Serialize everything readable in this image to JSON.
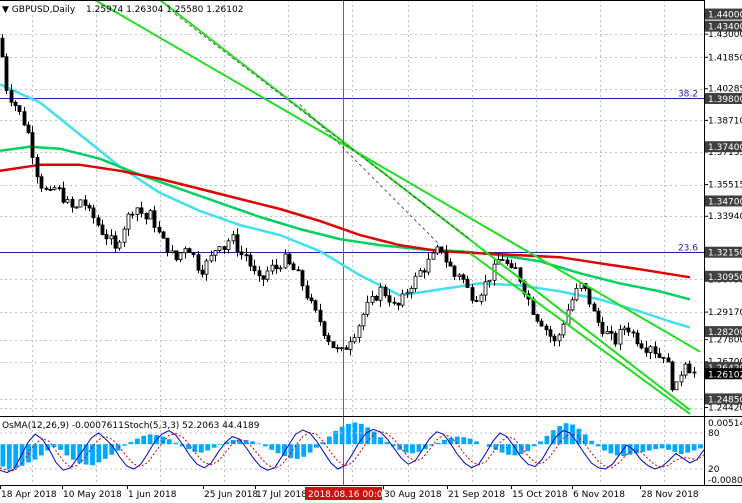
{
  "header": {
    "symbol_label": "GBPUSD,Daily",
    "ohlc_text": "1.25974 1.26304 1.25580 1.26102"
  },
  "indicator_header": {
    "osma_text": "OsMA(12,26,9) -0.0007611",
    "stoch_text": "Stoch(5,3,3) 52.2063 44.4189"
  },
  "colors": {
    "background": "#ffffff",
    "grid": "#c0c0c0",
    "axis_label": "#000000",
    "candle": "#000000",
    "ema_red": "#e00000",
    "ma_green": "#00d060",
    "ma_cyan": "#40e0f0",
    "channel": "#22dd22",
    "fib_line": "#2020a0",
    "fib_text": "#2020c0",
    "vline": "#c04040",
    "osma_bar": "#00a8ff",
    "stoch_main": "#0000d0",
    "stoch_signal": "#d00000",
    "price_tag_bg": "#000000",
    "price_tag_fg": "#ffffff",
    "time_tag_bg": "#d01010"
  },
  "chart_data": {
    "type": "candlestick",
    "price_axis": {
      "ylim": [
        1.24,
        1.447
      ],
      "ticks": [
        "1.43000",
        "1.41850",
        "1.40285",
        "1.38710",
        "1.37135",
        "1.35515",
        "1.33940",
        "1.32150",
        "1.30795",
        "1.29170",
        "1.27800",
        "1.26700",
        "1.24850",
        "1.24420"
      ],
      "highlighted_levels": [
        "1.44000",
        "1.43400",
        "1.39800",
        "1.37400",
        "1.34700",
        "1.32150",
        "1.30950",
        "1.28200",
        "1.26420",
        "1.26102",
        "1.24850"
      ],
      "current_price": "1.26102"
    },
    "fib_levels": [
      {
        "label": "38.2",
        "price": 1.398
      },
      {
        "label": "23.6",
        "price": 1.3215
      }
    ],
    "x_axis": {
      "labels": [
        "18 Apr 2018",
        "10 May 2018",
        "1 Jun 2018",
        "25 Jun 2018",
        "17 Jul 2018",
        "2018.08.16 00:00",
        "30 Aug 2018",
        "21 Sep 2018",
        "15 Oct 2018",
        "6 Nov 2018",
        "28 Nov 2018"
      ],
      "highlighted_label_index": 5
    },
    "indicator_axis": {
      "top_label": "0.005141",
      "stoch_80": "80",
      "stoch_20": "20",
      "bottom_label": "-0.00803"
    },
    "close_path": [
      [
        0,
        1.428
      ],
      [
        5,
        1.405
      ],
      [
        10,
        1.399
      ],
      [
        15,
        1.395
      ],
      [
        20,
        1.39
      ],
      [
        25,
        1.385
      ],
      [
        30,
        1.378
      ],
      [
        35,
        1.364
      ],
      [
        40,
        1.356
      ],
      [
        45,
        1.352
      ],
      [
        50,
        1.35
      ],
      [
        55,
        1.354
      ],
      [
        60,
        1.351
      ],
      [
        65,
        1.347
      ],
      [
        70,
        1.344
      ],
      [
        75,
        1.342
      ],
      [
        80,
        1.348
      ],
      [
        85,
        1.345
      ],
      [
        90,
        1.34
      ],
      [
        95,
        1.338
      ],
      [
        100,
        1.333
      ],
      [
        105,
        1.33
      ],
      [
        110,
        1.328
      ],
      [
        115,
        1.322
      ],
      [
        120,
        1.33
      ],
      [
        125,
        1.336
      ],
      [
        130,
        1.341
      ],
      [
        135,
        1.345
      ],
      [
        140,
        1.342
      ],
      [
        145,
        1.338
      ],
      [
        150,
        1.34
      ],
      [
        155,
        1.335
      ],
      [
        160,
        1.329
      ],
      [
        165,
        1.325
      ],
      [
        170,
        1.322
      ],
      [
        175,
        1.317
      ],
      [
        180,
        1.321
      ],
      [
        185,
        1.325
      ],
      [
        190,
        1.323
      ],
      [
        195,
        1.318
      ],
      [
        200,
        1.312
      ],
      [
        205,
        1.315
      ],
      [
        210,
        1.318
      ],
      [
        215,
        1.323
      ],
      [
        220,
        1.327
      ],
      [
        225,
        1.323
      ],
      [
        230,
        1.33
      ],
      [
        235,
        1.326
      ],
      [
        240,
        1.32
      ],
      [
        245,
        1.321
      ],
      [
        250,
        1.315
      ],
      [
        255,
        1.31
      ],
      [
        260,
        1.306
      ],
      [
        265,
        1.31
      ],
      [
        270,
        1.314
      ],
      [
        275,
        1.313
      ],
      [
        280,
        1.316
      ],
      [
        285,
        1.318
      ],
      [
        290,
        1.314
      ],
      [
        295,
        1.312
      ],
      [
        300,
        1.308
      ],
      [
        305,
        1.302
      ],
      [
        310,
        1.296
      ],
      [
        315,
        1.291
      ],
      [
        320,
        1.287
      ],
      [
        325,
        1.281
      ],
      [
        330,
        1.277
      ],
      [
        335,
        1.273
      ],
      [
        340,
        1.271
      ],
      [
        345,
        1.274
      ],
      [
        350,
        1.279
      ],
      [
        355,
        1.282
      ],
      [
        360,
        1.287
      ],
      [
        365,
        1.293
      ],
      [
        370,
        1.296
      ],
      [
        375,
        1.299
      ],
      [
        380,
        1.303
      ],
      [
        385,
        1.301
      ],
      [
        390,
        1.298
      ],
      [
        395,
        1.293
      ],
      [
        400,
        1.296
      ],
      [
        405,
        1.301
      ],
      [
        410,
        1.305
      ],
      [
        415,
        1.308
      ],
      [
        420,
        1.312
      ],
      [
        425,
        1.314
      ],
      [
        430,
        1.318
      ],
      [
        435,
        1.32
      ],
      [
        440,
        1.325
      ],
      [
        445,
        1.318
      ],
      [
        450,
        1.314
      ],
      [
        455,
        1.309
      ],
      [
        460,
        1.312
      ],
      [
        465,
        1.305
      ],
      [
        470,
        1.301
      ],
      [
        475,
        1.299
      ],
      [
        480,
        1.302
      ],
      [
        485,
        1.306
      ],
      [
        490,
        1.31
      ],
      [
        495,
        1.314
      ],
      [
        500,
        1.32
      ],
      [
        505,
        1.317
      ],
      [
        510,
        1.311
      ],
      [
        515,
        1.313
      ],
      [
        520,
        1.308
      ],
      [
        525,
        1.302
      ],
      [
        530,
        1.296
      ],
      [
        535,
        1.29
      ],
      [
        540,
        1.288
      ],
      [
        545,
        1.284
      ],
      [
        550,
        1.28
      ],
      [
        555,
        1.276
      ],
      [
        560,
        1.282
      ],
      [
        565,
        1.29
      ],
      [
        570,
        1.296
      ],
      [
        575,
        1.301
      ],
      [
        580,
        1.305
      ],
      [
        585,
        1.302
      ],
      [
        590,
        1.296
      ],
      [
        595,
        1.289
      ],
      [
        600,
        1.285
      ],
      [
        605,
        1.282
      ],
      [
        610,
        1.279
      ],
      [
        615,
        1.277
      ],
      [
        620,
        1.281
      ],
      [
        625,
        1.285
      ],
      [
        630,
        1.283
      ],
      [
        635,
        1.279
      ],
      [
        640,
        1.277
      ],
      [
        645,
        1.274
      ],
      [
        650,
        1.276
      ],
      [
        655,
        1.272
      ],
      [
        660,
        1.269
      ],
      [
        665,
        1.272
      ],
      [
        670,
        1.258
      ],
      [
        675,
        1.252
      ],
      [
        680,
        1.261
      ],
      [
        685,
        1.268
      ],
      [
        690,
        1.263
      ],
      [
        695,
        1.261
      ]
    ],
    "ema_red": [
      [
        0,
        1.362
      ],
      [
        40,
        1.365
      ],
      [
        80,
        1.365
      ],
      [
        120,
        1.362
      ],
      [
        160,
        1.358
      ],
      [
        200,
        1.353
      ],
      [
        240,
        1.348
      ],
      [
        280,
        1.343
      ],
      [
        320,
        1.337
      ],
      [
        360,
        1.33
      ],
      [
        400,
        1.325
      ],
      [
        440,
        1.322
      ],
      [
        480,
        1.321
      ],
      [
        520,
        1.32
      ],
      [
        560,
        1.319
      ],
      [
        600,
        1.316
      ],
      [
        640,
        1.313
      ],
      [
        690,
        1.309
      ]
    ],
    "ma_green": [
      [
        0,
        1.372
      ],
      [
        30,
        1.374
      ],
      [
        60,
        1.373
      ],
      [
        100,
        1.368
      ],
      [
        140,
        1.36
      ],
      [
        180,
        1.353
      ],
      [
        220,
        1.346
      ],
      [
        260,
        1.339
      ],
      [
        300,
        1.333
      ],
      [
        340,
        1.328
      ],
      [
        380,
        1.325
      ],
      [
        420,
        1.323
      ],
      [
        460,
        1.322
      ],
      [
        500,
        1.32
      ],
      [
        540,
        1.317
      ],
      [
        580,
        1.311
      ],
      [
        620,
        1.306
      ],
      [
        660,
        1.302
      ],
      [
        690,
        1.298
      ]
    ],
    "ma_cyan": [
      [
        0,
        1.405
      ],
      [
        40,
        1.396
      ],
      [
        80,
        1.38
      ],
      [
        120,
        1.364
      ],
      [
        160,
        1.351
      ],
      [
        200,
        1.342
      ],
      [
        240,
        1.335
      ],
      [
        280,
        1.33
      ],
      [
        320,
        1.322
      ],
      [
        360,
        1.31
      ],
      [
        400,
        1.3
      ],
      [
        440,
        1.303
      ],
      [
        480,
        1.306
      ],
      [
        520,
        1.305
      ],
      [
        560,
        1.302
      ],
      [
        600,
        1.298
      ],
      [
        640,
        1.292
      ],
      [
        670,
        1.287
      ],
      [
        690,
        1.284
      ]
    ],
    "channel_lines": [
      {
        "x0": 95,
        "y0": 1.447,
        "x1": 700,
        "y1": 1.272
      },
      {
        "x0": 160,
        "y0": 1.447,
        "x1": 690,
        "y1": 1.243
      },
      {
        "x0": 300,
        "y0": 1.395,
        "x1": 440,
        "y1": 1.325
      },
      {
        "x0": 470,
        "y0": 1.321,
        "x1": 690,
        "y1": 1.241
      }
    ],
    "osma": [
      -3.2,
      -3.6,
      -3.4,
      -3.1,
      -2.6,
      -2.2,
      -1.6,
      -0.9,
      -0.4,
      -0.8,
      -1.6,
      -2.2,
      -2.7,
      -2.9,
      -3.0,
      -2.6,
      -2.1,
      -1.5,
      -0.9,
      -0.2,
      0.3,
      0.8,
      1.2,
      1.4,
      1.3,
      1.1,
      0.7,
      0.2,
      -0.3,
      -0.7,
      -1.1,
      -1.2,
      -0.9,
      -0.5,
      -0.1,
      0.3,
      0.6,
      0.7,
      0.6,
      0.4,
      0.1,
      -0.3,
      -0.8,
      -1.3,
      -1.7,
      -2.0,
      -2.1,
      -1.8,
      -1.2,
      -0.5,
      0.3,
      1.1,
      1.9,
      2.5,
      2.9,
      3.1,
      2.9,
      2.4,
      1.8,
      1.0,
      0.3,
      -0.3,
      -0.8,
      -1.2,
      -1.3,
      -1.1,
      -0.7,
      -0.2,
      0.2,
      0.6,
      0.9,
      1.1,
      1.0,
      0.8,
      0.4,
      0.0,
      -0.4,
      -0.8,
      -1.2,
      -1.5,
      -1.6,
      -1.4,
      -1.0,
      -0.3,
      0.4,
      1.2,
      2.0,
      2.6,
      3.0,
      2.8,
      2.2,
      1.4,
      0.5,
      -0.3,
      -0.9,
      -1.3,
      -1.6,
      -1.7,
      -1.5,
      -1.3,
      -1.1,
      -0.9,
      -0.7,
      -0.6,
      -0.8,
      -1.1,
      -1.4,
      -1.2,
      -0.9,
      -0.6
    ],
    "stoch_main": [
      18,
      14,
      20,
      42,
      65,
      78,
      70,
      52,
      30,
      18,
      22,
      38,
      55,
      72,
      80,
      70,
      58,
      40,
      25,
      20,
      28,
      46,
      66,
      78,
      84,
      76,
      60,
      42,
      28,
      22,
      30,
      48,
      64,
      74,
      70,
      55,
      38,
      24,
      18,
      22,
      40,
      60,
      78,
      85,
      80,
      66,
      48,
      30,
      20,
      26,
      44,
      64,
      80,
      86,
      82,
      70,
      54,
      38,
      28,
      34,
      52,
      70,
      82,
      78,
      62,
      44,
      30,
      22,
      28,
      46,
      66,
      80,
      74,
      58,
      40,
      28,
      24,
      36,
      56,
      74,
      84,
      80,
      64,
      46,
      30,
      22,
      20,
      28,
      44,
      60,
      52,
      36,
      26,
      20,
      24,
      34,
      46,
      38,
      30,
      36,
      52
    ],
    "stoch_signal": [
      22,
      18,
      17,
      28,
      45,
      62,
      71,
      66,
      50,
      33,
      23,
      26,
      38,
      55,
      69,
      74,
      69,
      56,
      41,
      28,
      24,
      31,
      47,
      63,
      76,
      79,
      73,
      59,
      43,
      31,
      27,
      33,
      47,
      62,
      69,
      66,
      54,
      39,
      27,
      21,
      27,
      41,
      59,
      74,
      81,
      77,
      65,
      48,
      33,
      25,
      30,
      45,
      63,
      77,
      83,
      79,
      69,
      54,
      40,
      33,
      38,
      52,
      68,
      77,
      74,
      61,
      45,
      32,
      27,
      32,
      47,
      64,
      73,
      71,
      57,
      42,
      31,
      29,
      39,
      55,
      71,
      79,
      76,
      63,
      47,
      33,
      24,
      23,
      31,
      44,
      52,
      49,
      38,
      27,
      23,
      26,
      35,
      39,
      38,
      35,
      44
    ]
  }
}
